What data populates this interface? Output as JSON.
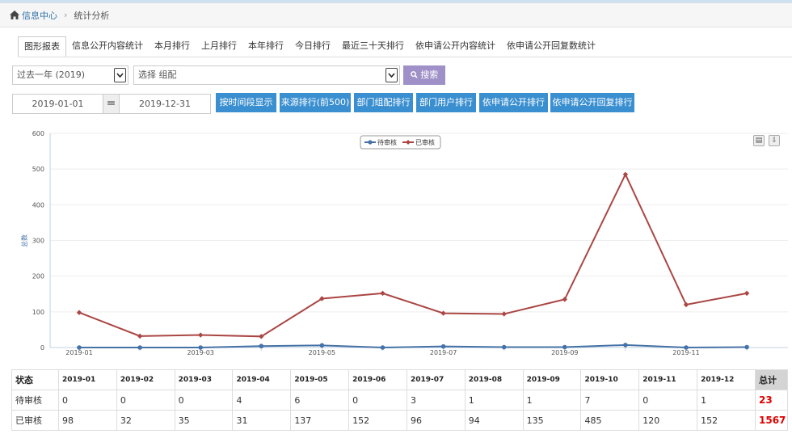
{
  "breadcrumb": {
    "home": "信息中心",
    "current": "统计分析"
  },
  "tabs": [
    "图形报表",
    "信息公开内容统计",
    "本月排行",
    "上月排行",
    "本年排行",
    "今日排行",
    "最近三十天排行",
    "依申请公开内容统计",
    "依申请公开回复数统计"
  ],
  "filters": {
    "period": "过去一年 (2019)",
    "group_placeholder": "选择 组配",
    "search_label": "搜索",
    "date_start": "2019-01-01",
    "date_end": "2019-12-31",
    "eq_sign": "="
  },
  "actions": [
    "按时间段显示",
    "来源排行(前500)",
    "部门组配排行",
    "部门用户排行",
    "依申请公开排行",
    "依申请公开回复排行"
  ],
  "colors": {
    "pending": "#4572a7",
    "approved": "#aa4643",
    "button": "#3a8fd0",
    "search": "#9f91c8"
  },
  "chart_data": {
    "type": "line",
    "ylabel": "总数",
    "ylim": [
      0,
      600
    ],
    "yticks": [
      0,
      100,
      200,
      300,
      400,
      500,
      600
    ],
    "categories": [
      "2019-01",
      "2019-02",
      "2019-03",
      "2019-04",
      "2019-05",
      "2019-06",
      "2019-07",
      "2019-08",
      "2019-09",
      "2019-10",
      "2019-11",
      "2019-12"
    ],
    "xtick_labels": [
      "2019-01",
      "2019-03",
      "2019-05",
      "2019-07",
      "2019-09",
      "2019-11"
    ],
    "legend_position": "top-center",
    "series": [
      {
        "name": "待审核",
        "values": [
          0,
          0,
          0,
          4,
          6,
          0,
          3,
          1,
          1,
          7,
          0,
          1
        ]
      },
      {
        "name": "已审核",
        "values": [
          98,
          32,
          35,
          31,
          137,
          152,
          96,
          94,
          135,
          485,
          120,
          152
        ]
      }
    ]
  },
  "table": {
    "status_header": "状态",
    "total_header": "总计",
    "months": [
      "2019-01",
      "2019-02",
      "2019-03",
      "2019-04",
      "2019-05",
      "2019-06",
      "2019-07",
      "2019-08",
      "2019-09",
      "2019-10",
      "2019-11",
      "2019-12"
    ],
    "rows": [
      {
        "label": "待审核",
        "values": [
          0,
          0,
          0,
          4,
          6,
          0,
          3,
          1,
          1,
          7,
          0,
          1
        ],
        "total": "23"
      },
      {
        "label": "已审核",
        "values": [
          98,
          32,
          35,
          31,
          137,
          152,
          96,
          94,
          135,
          485,
          120,
          152
        ],
        "total": "1567"
      }
    ]
  }
}
